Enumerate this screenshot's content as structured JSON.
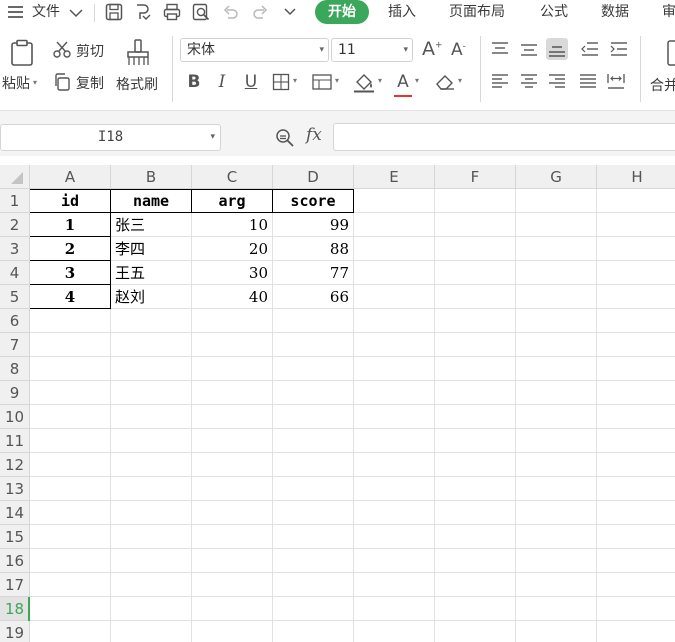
{
  "menu": {
    "file_label": "文件",
    "tabs": [
      {
        "label": "开始"
      },
      {
        "label": "插入"
      },
      {
        "label": "页面布局"
      },
      {
        "label": "公式"
      },
      {
        "label": "数据"
      },
      {
        "label": "审"
      }
    ]
  },
  "ribbon": {
    "paste_label": "粘贴",
    "cut_label": "剪切",
    "copy_label": "复制",
    "format_painter_label": "格式刷",
    "font_name": "宋体",
    "font_size": "11",
    "bold_label": "B",
    "italic_label": "I",
    "underline_label": "U",
    "font_color_label": "A",
    "merge_label": "合并",
    "font_color_hex": "#e8322b"
  },
  "formula_bar": {
    "cell_ref": "I18",
    "fx_label": "fx",
    "formula": ""
  },
  "sheet": {
    "columns": [
      "A",
      "B",
      "C",
      "D",
      "E",
      "F",
      "G",
      "H"
    ],
    "rows": [
      "1",
      "2",
      "3",
      "4",
      "5",
      "6",
      "7",
      "8",
      "9",
      "10",
      "11",
      "12",
      "13",
      "14",
      "15",
      "16",
      "17",
      "18",
      "19"
    ],
    "selected_row": "18",
    "header": {
      "id": "id",
      "name": "name",
      "arg": "arg",
      "score": "score"
    },
    "records": [
      {
        "id": "1",
        "name": "张三",
        "arg": "10",
        "score": "99"
      },
      {
        "id": "2",
        "name": "李四",
        "arg": "20",
        "score": "88"
      },
      {
        "id": "3",
        "name": "王五",
        "arg": "30",
        "score": "77"
      },
      {
        "id": "4",
        "name": "赵刘",
        "arg": "40",
        "score": "66"
      }
    ]
  },
  "colors": {
    "accent": "#3ba75a"
  }
}
